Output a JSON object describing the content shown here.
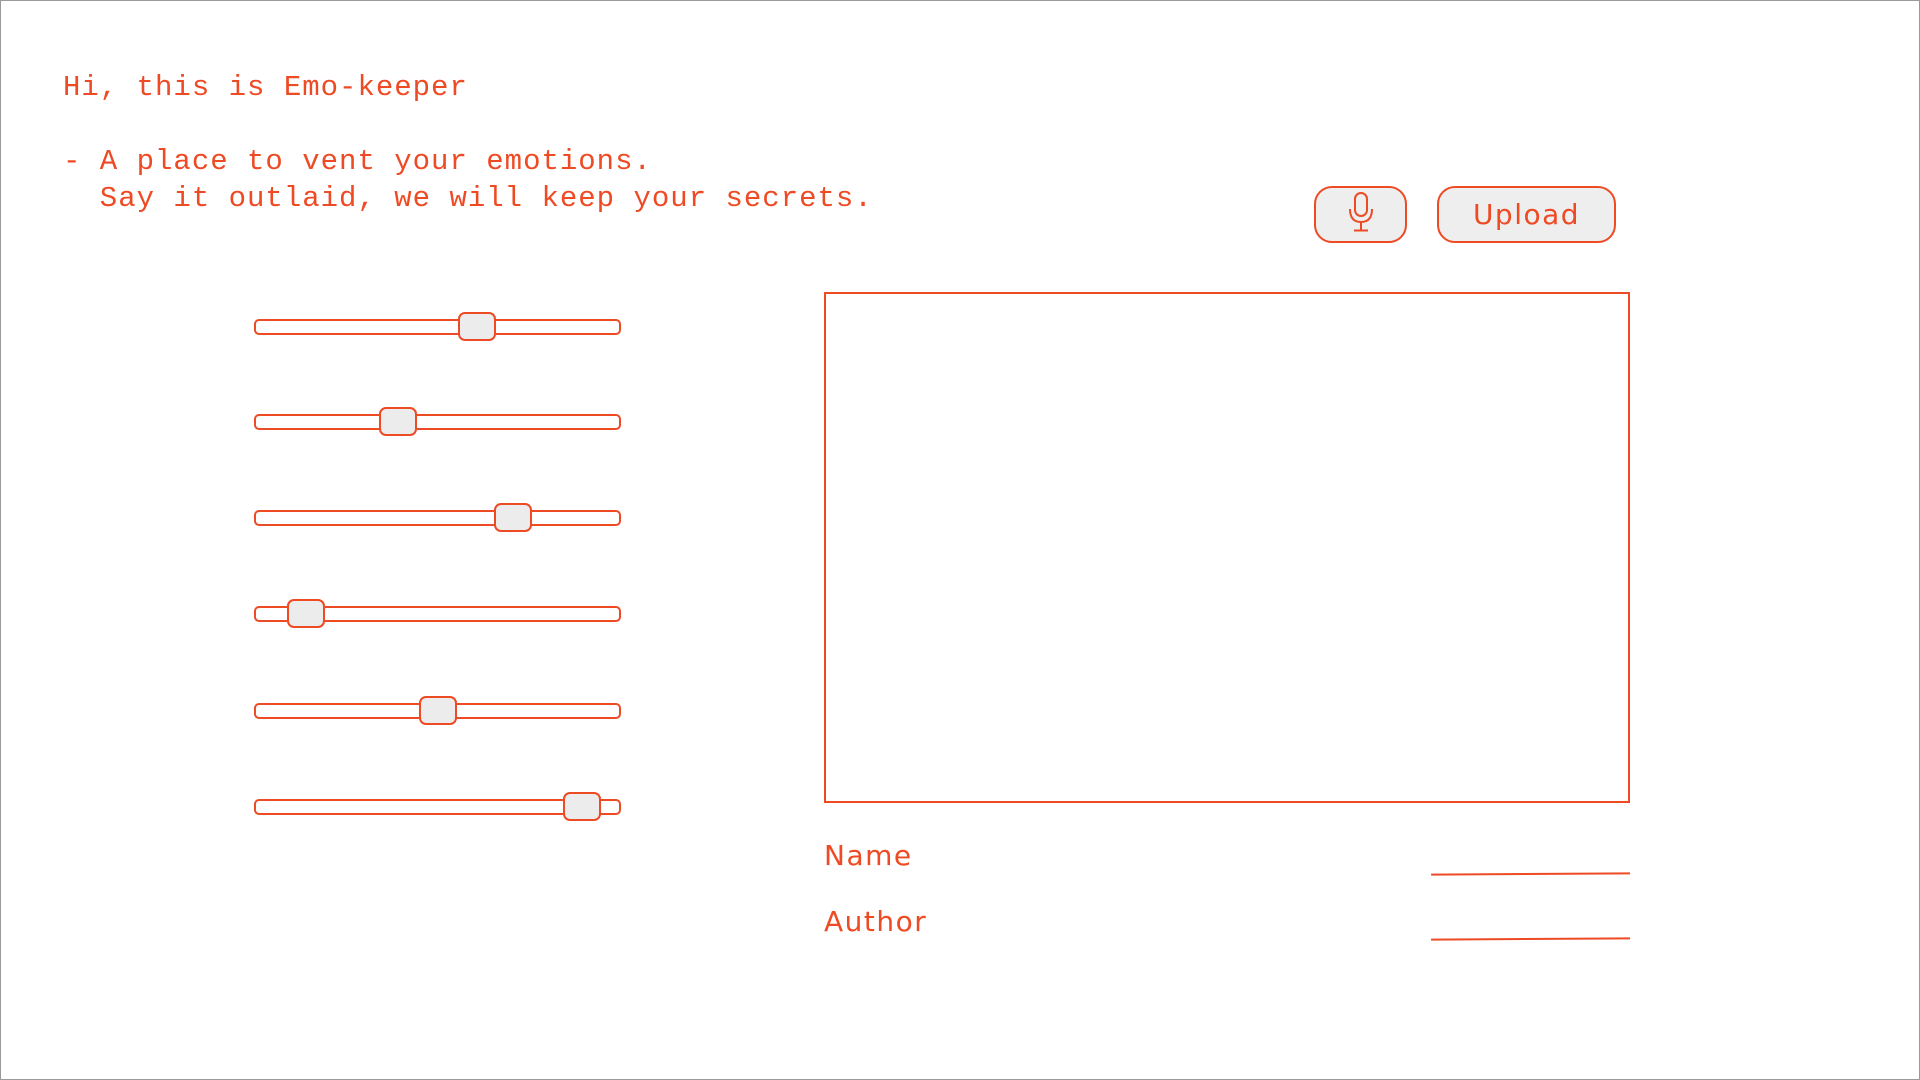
{
  "header": {
    "greeting": "Hi, this is Emo-keeper",
    "intro": "- A place to vent your emotions.\n  Say it outlaid, we will keep your secrets."
  },
  "toolbar": {
    "mic_icon": "microphone-icon",
    "upload_label": "Upload"
  },
  "sliders": [
    {
      "value_percent": 62
    },
    {
      "value_percent": 38
    },
    {
      "value_percent": 73
    },
    {
      "value_percent": 10
    },
    {
      "value_percent": 50
    },
    {
      "value_percent": 94
    }
  ],
  "form": {
    "name_label": "Name",
    "name_value": "",
    "author_label": "Author",
    "author_value": ""
  },
  "colors": {
    "accent": "#ee4a24",
    "button_fill": "#eeeeee",
    "border": "#9a9a9a"
  }
}
